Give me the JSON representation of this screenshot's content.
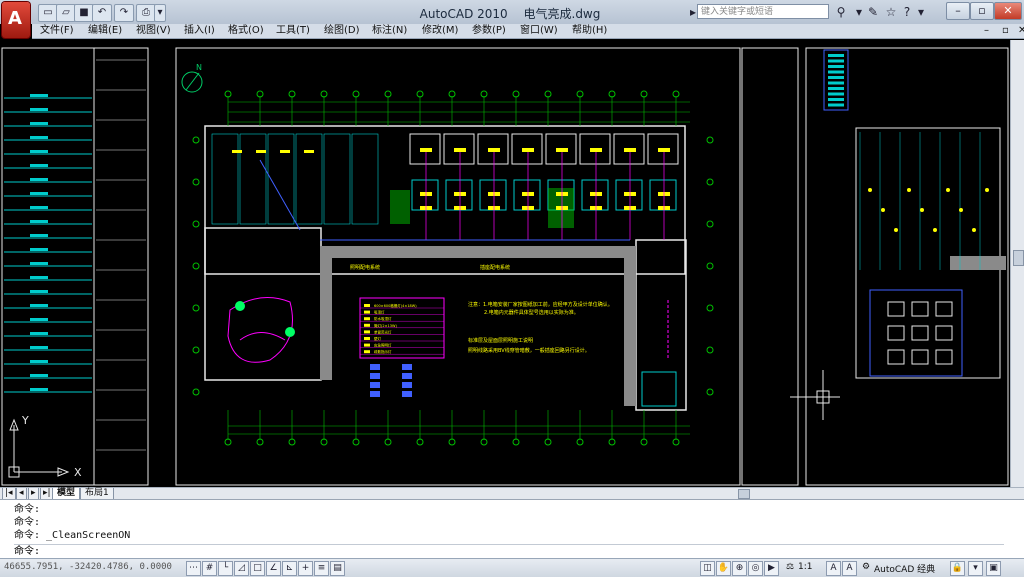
{
  "window": {
    "app_name": "AutoCAD 2010",
    "file_name": "电气亮成.dwg",
    "search_placeholder": "键入关键字或短语"
  },
  "menu": [
    "文件(F)",
    "编辑(E)",
    "视图(V)",
    "插入(I)",
    "格式(O)",
    "工具(T)",
    "绘图(D)",
    "标注(N)",
    "修改(M)",
    "参数(P)",
    "窗口(W)",
    "帮助(H)"
  ],
  "drawing": {
    "north_label": "N",
    "axis_x": "X",
    "axis_y": "Y",
    "legend_titles": [
      "照明配电系统",
      "插座配电系统"
    ],
    "legend_rows": [
      "600×600格栅灯(4×18W)",
      "吸顶灯",
      "防水吸顶灯",
      "筒灯(2×13W)",
      "单管荧光灯",
      "壁灯",
      "应急照明灯",
      "疏散指示灯"
    ],
    "notes": [
      "注意：1.电箱安装厂家按图纸加工前，应经甲方及设计单位确认。",
      "2.电箱内元器件具体型号选用以实际为准。",
      "标准层及屋面层照明施工说明",
      "照明线路采用BV线穿管暗敷，一般插座回路另行设计。"
    ],
    "colors": {
      "background": "#000000",
      "grid_cyan": "#00cccc",
      "wall_white": "#e8e8e8",
      "fixture_yellow": "#ffff00",
      "wiring_magenta": "#ff00ff",
      "axis_green": "#00c000",
      "legend_blue": "#4060ff",
      "corridor_grey": "#8a8a8a"
    }
  },
  "tabs": {
    "model": "模型",
    "layout": "布局1"
  },
  "command": {
    "history": [
      "命令:",
      "命令:",
      "命令: _CleanScreenON"
    ],
    "prompt": "命令:"
  },
  "status": {
    "coordinates": "46655.7951, -32420.4786, 0.0000",
    "scale": "1:1",
    "workspace": "AutoCAD 经典"
  }
}
